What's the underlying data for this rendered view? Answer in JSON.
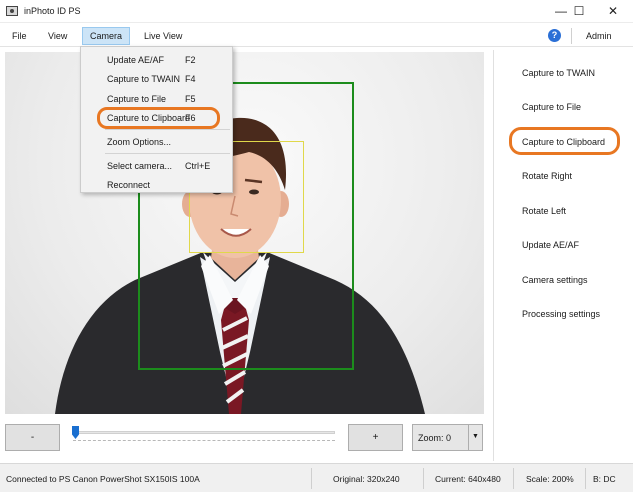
{
  "window": {
    "title": "inPhoto ID PS",
    "minimize": "—",
    "maximize": "☐",
    "close": "✕"
  },
  "menu": {
    "items": [
      "File",
      "View",
      "Camera",
      "Live View"
    ],
    "help_icon": "?",
    "user": "Admin"
  },
  "camera_menu": {
    "items": [
      {
        "label": "Update AE/AF",
        "key": "F2"
      },
      {
        "label": "Capture to TWAIN",
        "key": "F4"
      },
      {
        "label": "Capture to File",
        "key": "F5"
      },
      {
        "label": "Capture to Clipboard",
        "key": "F6"
      },
      {
        "label": "Zoom Options...",
        "key": ""
      },
      {
        "label": "Select camera...",
        "key": "Ctrl+E"
      },
      {
        "label": "Reconnect",
        "key": ""
      }
    ]
  },
  "controls": {
    "minus": "-",
    "plus": "+",
    "zoom": "Zoom: 0",
    "zoom_arrow": "▼"
  },
  "side_buttons": [
    "Capture to TWAIN",
    "Capture to File",
    "Capture to Clipboard",
    "Rotate Right",
    "Rotate Left",
    "Update AE/AF",
    "Camera settings",
    "Processing settings"
  ],
  "status": {
    "connection": "Connected to PS Canon PowerShot SX150IS 100A",
    "original": "Original: 320x240",
    "current": "Current: 640x480",
    "scale": "Scale: 200%",
    "b": "B: DC"
  },
  "colors": {
    "highlight": "#e87722",
    "face_frame": "#1c8c1c",
    "eye_frame": "#e0d84a",
    "accent": "#1a6fd0"
  }
}
